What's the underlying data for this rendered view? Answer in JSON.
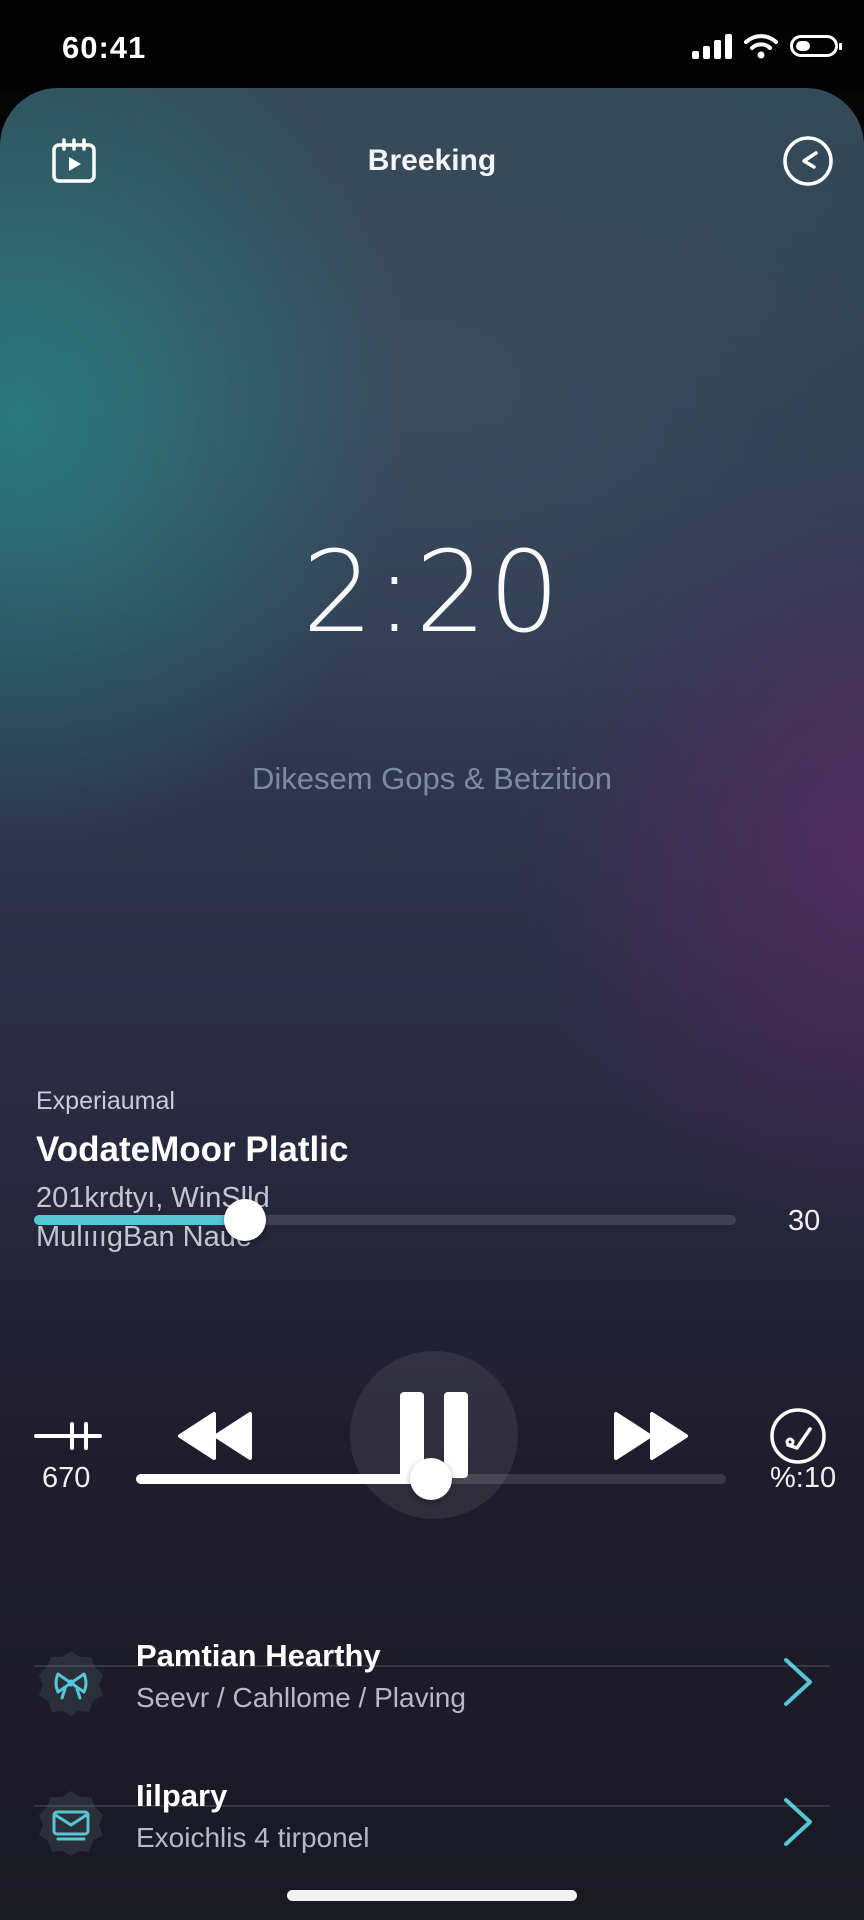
{
  "status": {
    "time": "60:41"
  },
  "header": {
    "title": "Breeking",
    "left_icon": "calendar-play-icon",
    "right_icon": "timer-icon"
  },
  "clock": {
    "time": "2:20",
    "subtitle": "Dikesem Gops & Betzition"
  },
  "track": {
    "genre": "Experiaumal",
    "title": "VodateMoor Platlic",
    "meta_line1": "201krdtyı, WinSlld",
    "meta_line2": "MulıııgBan Naue"
  },
  "progress": {
    "end_label": "30",
    "value": 0.3
  },
  "controls": {
    "left_icon": "equalizer-icon",
    "rewind_icon": "rewind-icon",
    "pause_icon": "pause-icon",
    "forward_icon": "fast-forward-icon",
    "right_icon": "check-circle-icon"
  },
  "volume": {
    "left_label": "670",
    "right_label": "%:10",
    "value": 0.5
  },
  "list": [
    {
      "title": "Pamtian Hearthy",
      "subtitle": "Seevr / Cahllome / Plaving",
      "icon": "ribbon-badge-icon"
    },
    {
      "title": "Iilpary",
      "subtitle": "Exoichlis 4 tirponel",
      "icon": "mail-badge-icon"
    }
  ],
  "colors": {
    "accent": "#55c6d6",
    "progress_fill": "#55c6d6",
    "volume_fill": "#ffffff"
  }
}
